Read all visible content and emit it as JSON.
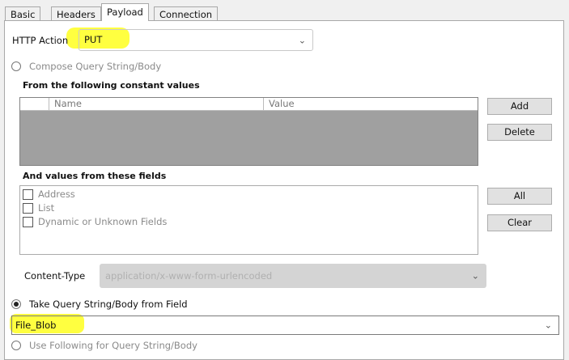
{
  "tabs": [
    {
      "label": "Basic"
    },
    {
      "label": "Headers"
    },
    {
      "label": "Payload"
    },
    {
      "label": "Connection"
    }
  ],
  "http_action": {
    "label": "HTTP Action",
    "value": "PUT"
  },
  "compose": {
    "label": "Compose Query String/Body",
    "selected": false
  },
  "constants": {
    "label": "From the following constant values",
    "columns": [
      "Name",
      "Value"
    ],
    "add": "Add",
    "delete": "Delete"
  },
  "fields": {
    "label": "And values from these fields",
    "items": [
      "Address",
      "List",
      "Dynamic or Unknown Fields"
    ],
    "all": "All",
    "clear": "Clear"
  },
  "content_type": {
    "label": "Content-Type",
    "value": "application/x-www-form-urlencoded"
  },
  "take_from_field": {
    "label": "Take Query String/Body from Field",
    "selected": true,
    "value": "File_Blob"
  },
  "use_following": {
    "label": "Use Following for Query String/Body",
    "selected": false
  }
}
